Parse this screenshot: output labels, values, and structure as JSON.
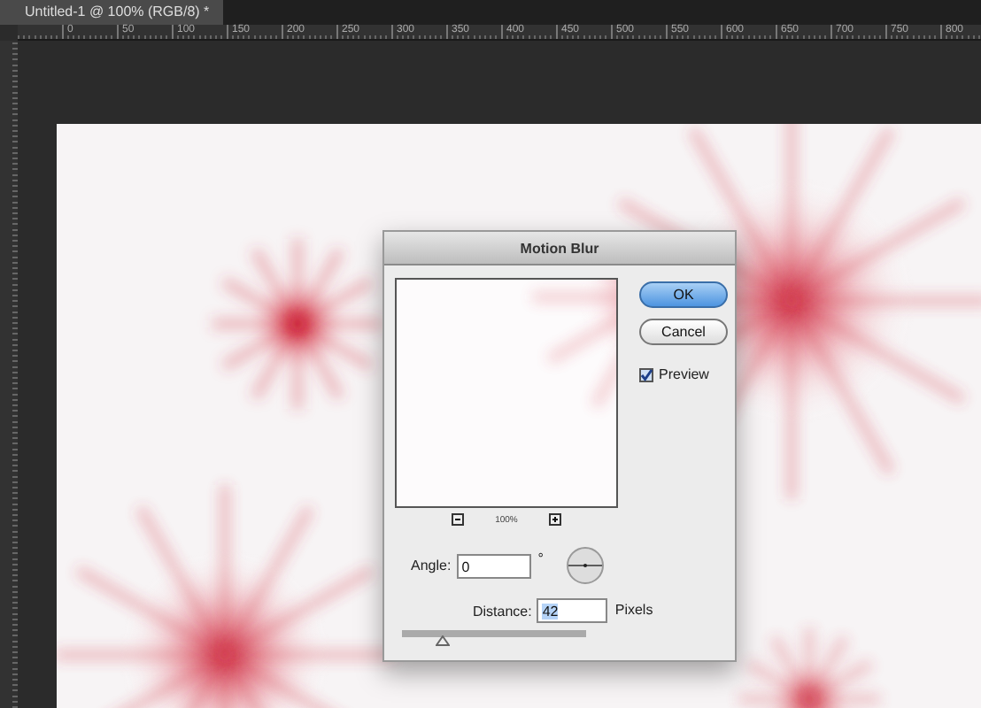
{
  "document_tab": {
    "title": "Untitled-1 @ 100% (RGB/8) *",
    "selected": true
  },
  "ruler": {
    "labels": [
      "0",
      "50",
      "100",
      "150",
      "200",
      "250",
      "300",
      "350",
      "400",
      "450",
      "500",
      "550",
      "600",
      "650",
      "700",
      "750",
      "800"
    ]
  },
  "dialog": {
    "title": "Motion Blur",
    "zoom": "100%",
    "buttons": [
      {
        "label": "OK",
        "kind": "default"
      },
      {
        "label": "Cancel",
        "kind": "normal"
      }
    ],
    "preview": {
      "label": "Preview",
      "checked": true
    },
    "angle": {
      "label": "Angle:",
      "value": "0",
      "unit": "°"
    },
    "distance": {
      "label": "Distance:",
      "value": "42",
      "unit": "Pixels",
      "selected": true,
      "level": 0.22
    }
  }
}
